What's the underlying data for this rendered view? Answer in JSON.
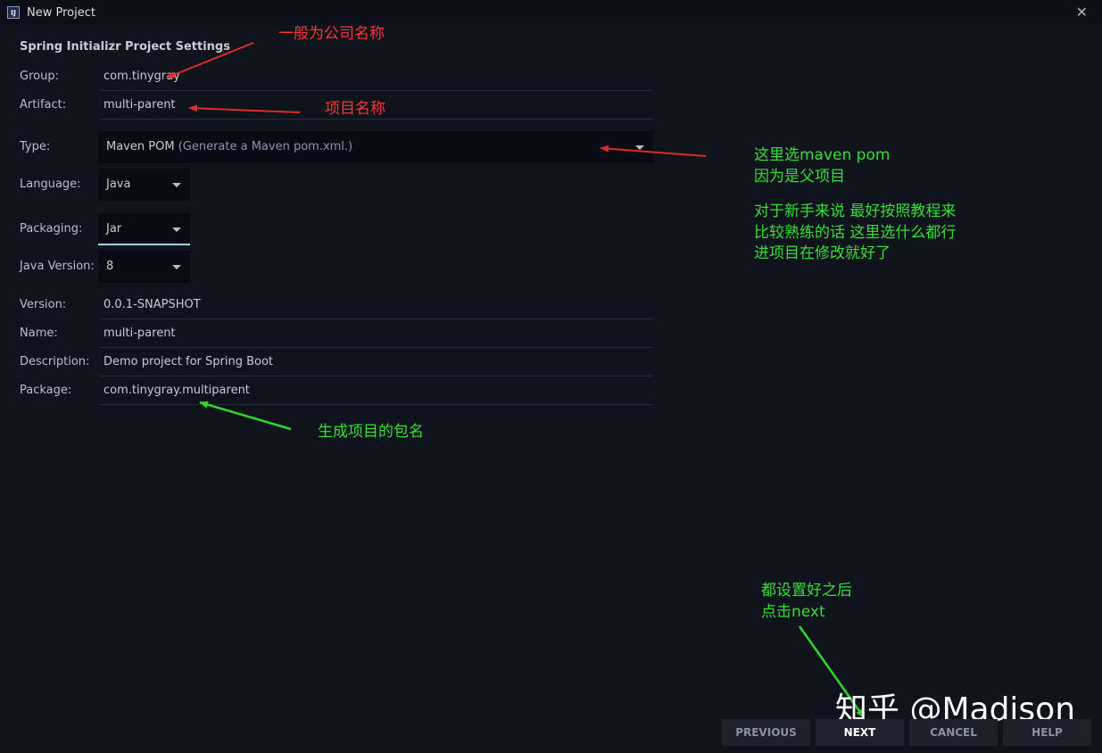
{
  "window": {
    "title": "New Project",
    "icon": "intellij-icon"
  },
  "settings": {
    "section_title": "Spring Initializr Project Settings",
    "group": {
      "label": "Group:",
      "value": "com.tinygray"
    },
    "artifact": {
      "label": "Artifact:",
      "value": "multi-parent"
    },
    "type": {
      "label": "Type:",
      "value": "Maven POM",
      "hint": "(Generate a Maven pom.xml.)"
    },
    "language": {
      "label": "Language:",
      "value": "Java"
    },
    "packaging": {
      "label": "Packaging:",
      "value": "Jar"
    },
    "java_version": {
      "label": "Java Version:",
      "value": "8"
    },
    "version": {
      "label": "Version:",
      "value": "0.0.1-SNAPSHOT"
    },
    "name": {
      "label": "Name:",
      "value": "multi-parent"
    },
    "description": {
      "label": "Description:",
      "value": "Demo project for Spring Boot"
    },
    "package": {
      "label": "Package:",
      "value": "com.tinygray.multiparent"
    }
  },
  "annotations": {
    "group_note": "一般为公司名称",
    "artifact_note": "项目名称",
    "type_note": [
      "这里选maven pom",
      "因为是父项目",
      "",
      "对于新手来说 最好按照教程来",
      "比较熟练的话 这里选什么都行",
      "进项目在修改就好了"
    ],
    "package_note": "生成项目的包名",
    "next_note": [
      "都设置好之后",
      "点击next"
    ]
  },
  "watermark": "知乎 @Madison",
  "buttons": {
    "previous": "PREVIOUS",
    "next": "NEXT",
    "cancel": "CANCEL",
    "help": "HELP"
  },
  "colors": {
    "background": "#0f131c",
    "annotation_red": "#ff3535",
    "annotation_green": "#34e034"
  }
}
